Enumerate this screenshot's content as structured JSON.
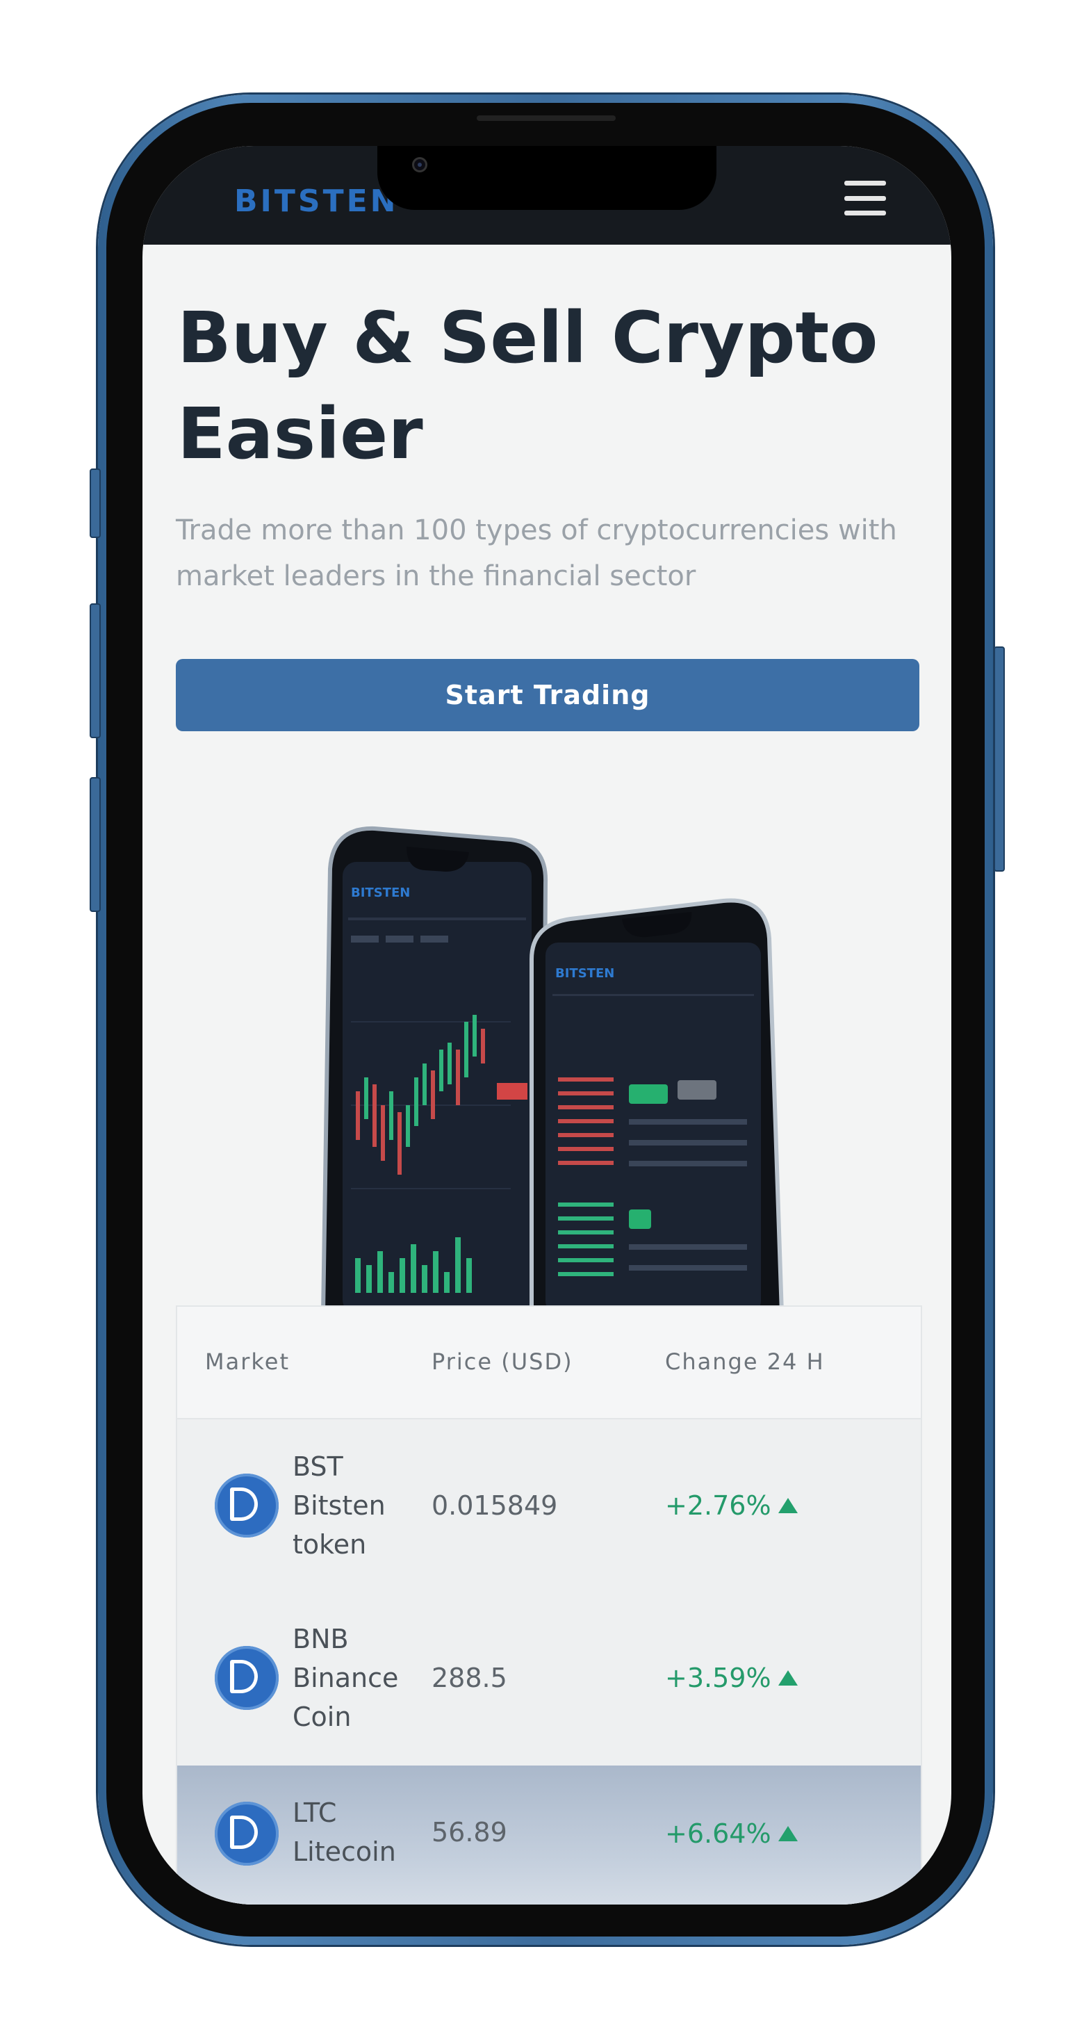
{
  "header": {
    "logo": "BITSTEN"
  },
  "hero": {
    "title": "Buy & Sell Crypto Easier",
    "subtitle": "Trade more than 100 types of cryptocurrencies with market leaders in the financial sector",
    "cta_label": "Start Trading"
  },
  "illustration": {
    "logo_text": "BITSTEN"
  },
  "market_table": {
    "headers": [
      "Market",
      "Price (USD)",
      "Change 24 H"
    ],
    "rows": [
      {
        "symbol": "BST",
        "name_line1": "Bitsten",
        "name_line2": "token",
        "price": "0.015849",
        "change": "+2.76%"
      },
      {
        "symbol": "BNB",
        "name_line1": "Binance",
        "name_line2": "Coin",
        "price": "288.5",
        "change": "+3.59%"
      },
      {
        "symbol": "LTC",
        "name_line1": "Litecoin",
        "name_line2": "",
        "price": "56.89",
        "change": "+6.64%"
      }
    ]
  },
  "colors": {
    "accent": "#3d6fa6",
    "logo": "#2b6fc0",
    "positive": "#249a6a",
    "header_bg": "#161a1f",
    "frame": "#3d6d9d"
  }
}
